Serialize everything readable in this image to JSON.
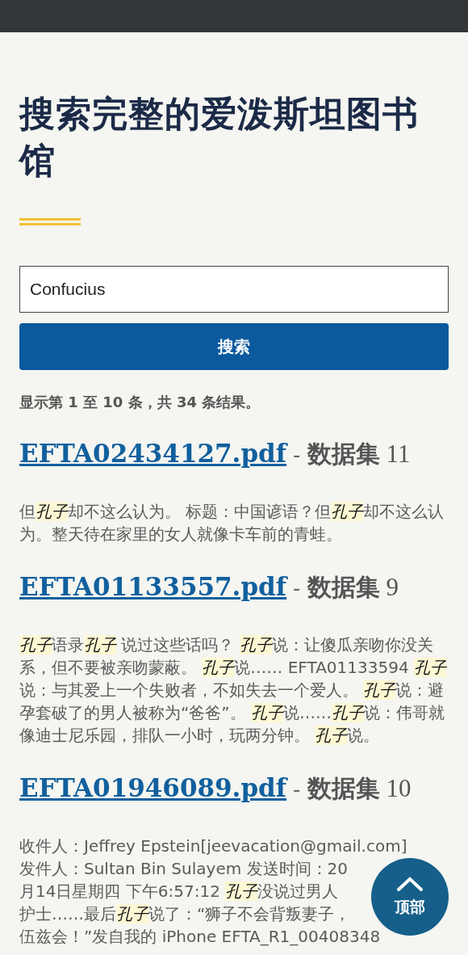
{
  "title": "搜索完整的爱泼斯坦图书馆",
  "search": {
    "value": "Confucius",
    "button": "搜索"
  },
  "summary": "显示第 1 至 10 条，共 34 条结果。",
  "results": [
    {
      "file": "EFTA02434127.pdf",
      "sep": "-",
      "dataset": "数据集",
      "number": "11",
      "lines": [
        [
          {
            "text": "但"
          },
          {
            "text": "孔子",
            "highlight": true
          },
          {
            "text": "却不这么认为。 标题：中国谚语？但"
          },
          {
            "text": "孔子",
            "highlight": true
          },
          {
            "text": "却不这么认为。整天待在家里的女人就像卡车前的青蛙。"
          }
        ]
      ]
    },
    {
      "file": "EFTA01133557.pdf",
      "sep": "-",
      "dataset": "数据集",
      "number": "9",
      "lines": [
        [
          {
            "text": "孔子",
            "highlight": true
          },
          {
            "text": "语录"
          },
          {
            "text": "孔子",
            "highlight": true
          },
          {
            "text": " 说过这些话吗？ "
          },
          {
            "text": "孔子",
            "highlight": true
          },
          {
            "text": "说：让傻瓜亲吻你没关系，但不要被亲吻蒙蔽。 "
          },
          {
            "text": "孔子",
            "highlight": true
          },
          {
            "text": "说…… EFTA01133594 "
          },
          {
            "text": "孔子",
            "highlight": true
          },
          {
            "text": "说：与其爱上一个失败者，不如失去一个爱人。 "
          },
          {
            "text": "孔子",
            "highlight": true
          },
          {
            "text": "说：避孕套破了的男人被称为“爸爸”。 "
          },
          {
            "text": "孔子",
            "highlight": true
          },
          {
            "text": "说……"
          },
          {
            "text": "孔子",
            "highlight": true
          },
          {
            "text": "说：伟哥就像迪士尼乐园，排队一小时，玩两分钟。 "
          },
          {
            "text": "孔子",
            "highlight": true
          },
          {
            "text": "说。"
          }
        ]
      ]
    },
    {
      "file": "EFTA01946089.pdf",
      "sep": "-",
      "dataset": "数据集",
      "number": "10",
      "lines": [
        [
          {
            "text": "收件人：Jeffrey Epstein[jeevacation@gmail.com]"
          }
        ],
        [
          {
            "text": "发件人：Sultan Bin Sulayem 发送时间：20"
          }
        ],
        [
          {
            "text": "月14日星期四 下午6:57:12 "
          },
          {
            "text": "孔子",
            "highlight": true
          },
          {
            "text": "没说过男人"
          }
        ],
        [
          {
            "text": "护士……最后"
          },
          {
            "text": "孔子",
            "highlight": true
          },
          {
            "text": "说了：“狮子不会背叛妻子，"
          }
        ],
        [
          {
            "text": "伍兹会！”发自我的 iPhone EFTA_R1_00408348"
          }
        ]
      ]
    }
  ],
  "top_button": "顶部"
}
